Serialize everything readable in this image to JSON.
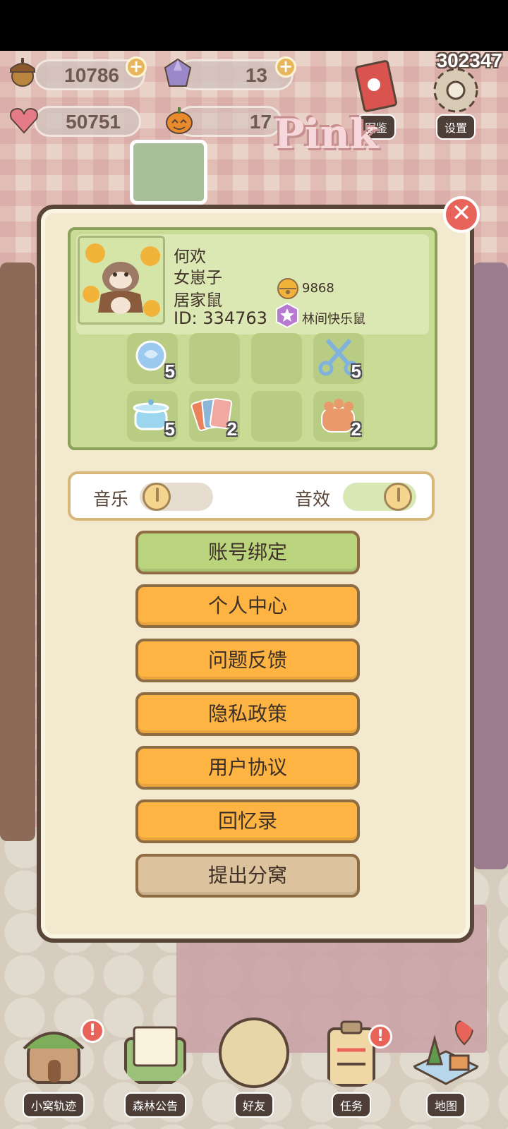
{
  "resources": {
    "acorns": "10786",
    "gems": "13",
    "hearts": "50751",
    "pumpkins": "17",
    "plus_glyph": "+"
  },
  "level_number": "302347",
  "top_buttons": {
    "collection_label": "图鉴",
    "settings_label": "设置"
  },
  "room_sign": "Pink",
  "profile": {
    "name": "何欢",
    "title": "女崽子",
    "role": "居家鼠",
    "id_text": "ID: 334763",
    "bells": "9868",
    "badge_title": "林间快乐鼠"
  },
  "inventory": [
    {
      "icon": "blue-rose-icon",
      "count": "5"
    },
    {
      "icon": "empty-slot",
      "count": ""
    },
    {
      "icon": "empty-slot",
      "count": ""
    },
    {
      "icon": "scissors-icon",
      "count": "5"
    },
    {
      "icon": "cooking-pot-icon",
      "count": "5"
    },
    {
      "icon": "cards-icon",
      "count": "2"
    },
    {
      "icon": "empty-slot",
      "count": ""
    },
    {
      "icon": "paw-icon",
      "count": "2"
    }
  ],
  "sound": {
    "music_label": "音乐",
    "music_on": false,
    "sfx_label": "音效",
    "sfx_on": true
  },
  "menu": {
    "account_bind": "账号绑定",
    "personal_center": "个人中心",
    "feedback": "问题反馈",
    "privacy": "隐私政策",
    "user_agreement": "用户协议",
    "memoir": "回忆录",
    "leave_nest": "提出分窝"
  },
  "close_glyph": "✕",
  "alert_glyph": "!",
  "bottom_nav": {
    "nest_trail": "小窝轨迹",
    "forest_notice": "森林公告",
    "friends": "好友",
    "tasks": "任务",
    "map": "地图"
  },
  "colors": {
    "accent_orange": "#fdb443",
    "accent_green": "#b9d47d",
    "tan": "#ddc39d",
    "frame_brown": "#5a4638",
    "alert_red": "#e8635a"
  }
}
